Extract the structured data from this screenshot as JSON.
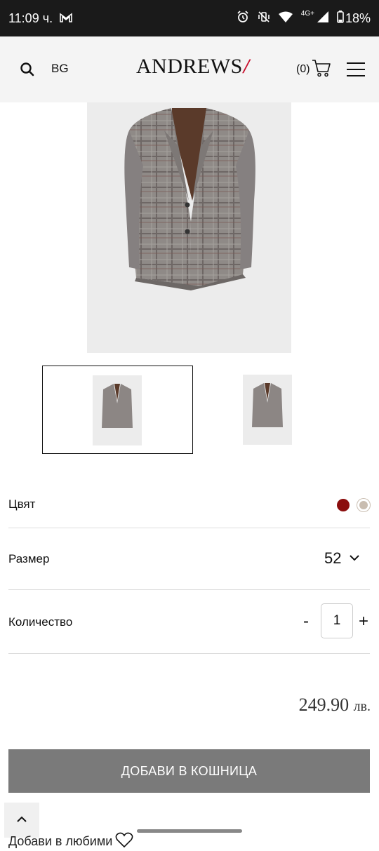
{
  "status_bar": {
    "time": "11:09 ч.",
    "network": "4G+",
    "battery": "18%"
  },
  "header": {
    "lang": "BG",
    "logo": "ANDREWS",
    "cart_count": "(0)"
  },
  "product": {
    "color_label": "Цвят",
    "colors": [
      "#8b0e0e",
      "#c9bdb0"
    ],
    "size_label": "Размер",
    "size_value": "52",
    "qty_label": "Количество",
    "qty_minus": "-",
    "qty_value": "1",
    "qty_plus": "+",
    "price": "249.90",
    "currency": "лв.",
    "add_to_cart": "ДОБАВИ В КОШНИЦА",
    "add_to_favorites": "Добави в любими"
  }
}
